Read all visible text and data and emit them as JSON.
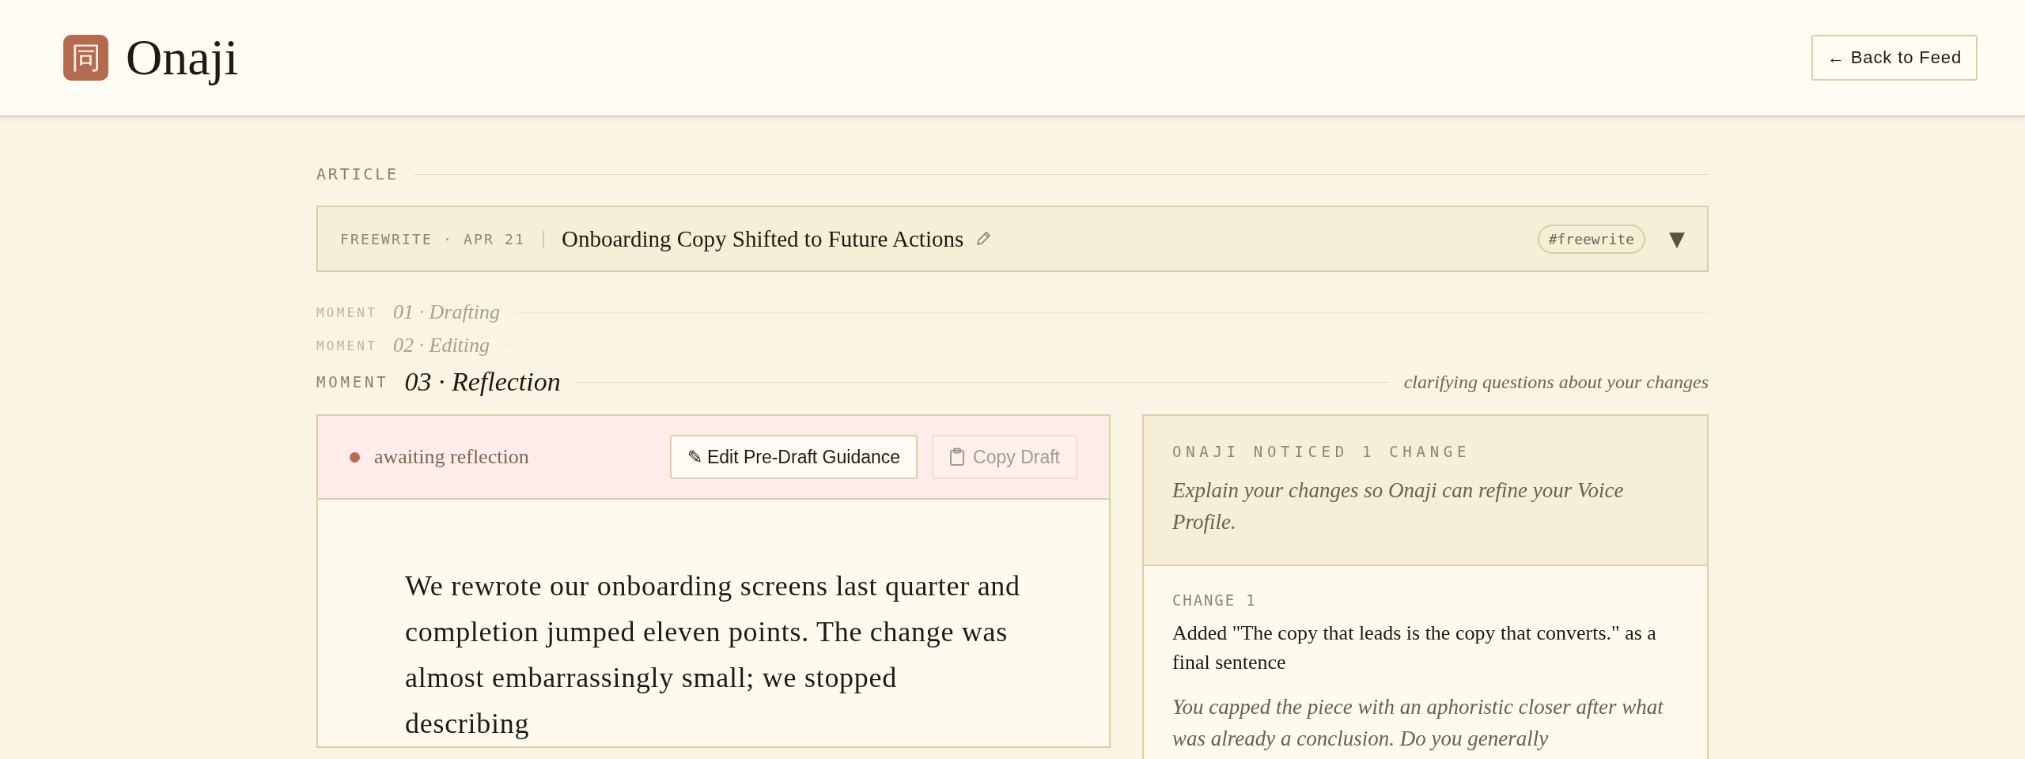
{
  "header": {
    "logo_glyph": "同",
    "brand": "Onaji",
    "back_button": "← Back to Feed"
  },
  "article": {
    "section_label": "ARTICLE",
    "meta": "FREEWRITE · APR 21",
    "title": "Onboarding Copy Shifted to Future Actions",
    "tag": "#freewrite",
    "toggle": "▼"
  },
  "moments": [
    {
      "label": "MOMENT",
      "title": "01 · Drafting",
      "selected": false
    },
    {
      "label": "MOMENT",
      "title": "02 · Editing",
      "selected": false
    },
    {
      "label": "MOMENT",
      "title": "03 · Reflection",
      "selected": true,
      "note": "clarifying questions about your changes"
    }
  ],
  "draft_card": {
    "status": {
      "text": "awaiting reflection",
      "color": "#b86b4f"
    },
    "buttons": [
      {
        "label": "✎ Edit Pre-Draft Guidance",
        "kind": "edit",
        "disabled": false
      },
      {
        "label": "Copy Draft",
        "kind": "copy",
        "disabled": true
      }
    ],
    "body": "We rewrote our onboarding screens last quarter and completion jumped eleven points. The change was almost embarrassingly small; we stopped describing"
  },
  "changes_panel": {
    "heading": "ONAJI NOTICED 1 CHANGE",
    "intro": "Explain your changes so Onaji can refine your Voice Profile.",
    "changes": [
      {
        "label": "CHANGE 1",
        "summary": "Added \"The copy that leads is the copy that converts.\" as a final sentence",
        "question": "You capped the piece with an aphoristic closer after what was already a conclusion. Do you generally"
      }
    ]
  }
}
